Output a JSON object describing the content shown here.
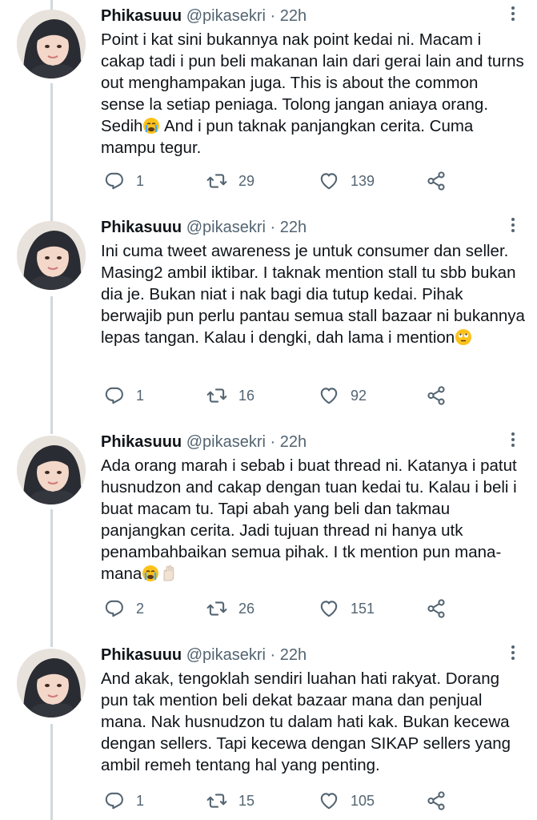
{
  "tweets": [
    {
      "name": "Phikasuuu",
      "handle": "@pikasekri",
      "separator": "·",
      "time": "22h",
      "text": "Point i kat sini bukannya nak point kedai ni. Macam i cakap tadi i pun beli makanan lain dari gerai lain and turns out menghampakan juga. This is about the common sense la setiap peniaga. Tolong jangan aniaya orang. Sedih",
      "text_after": " And i pun taknak panjangkan cerita. Cuma mampu tegur.",
      "emoji": "crying-face",
      "replies": "1",
      "retweets": "29",
      "likes": "139"
    },
    {
      "name": "Phikasuuu",
      "handle": "@pikasekri",
      "separator": "·",
      "time": "22h",
      "text": "Ini cuma tweet awareness je untuk consumer dan seller. Masing2 ambil iktibar. I taknak mention stall tu sbb bukan dia je. Bukan niat i nak bagi dia tutup kedai. Pihak berwajib pun perlu pantau semua stall bazaar ni bukannya lepas tangan. Kalau i dengki, dah lama i mention",
      "text_after": "",
      "emoji": "rolling-eyes-face",
      "replies": "1",
      "retweets": "16",
      "likes": "92"
    },
    {
      "name": "Phikasuuu",
      "handle": "@pikasekri",
      "separator": "·",
      "time": "22h",
      "text": "Ada orang marah i sebab i buat thread ni. Katanya i patut husnudzon and cakap dengan tuan kedai tu. Kalau i beli i buat macam tu. Tapi abah yang beli dan takmau panjangkan cerita. Jadi tujuan thread ni hanya utk penambahbaikan semua pihak. I tk mention pun mana-mana",
      "text_after": "",
      "emoji": "crying-face-raised-hand",
      "replies": "2",
      "retweets": "26",
      "likes": "151"
    },
    {
      "name": "Phikasuuu",
      "handle": "@pikasekri",
      "separator": "·",
      "time": "22h",
      "text": "And akak, tengoklah sendiri luahan hati rakyat. Dorang pun tak mention beli dekat bazaar mana dan penjual mana. Nak husnudzon tu dalam hati kak. Bukan kecewa dengan sellers. Tapi kecewa dengan SIKAP sellers yang ambil remeh tentang hal yang penting.",
      "text_after": "",
      "emoji": "",
      "replies": "1",
      "retweets": "15",
      "likes": "105"
    }
  ],
  "icons": {
    "reply": "reply-icon",
    "retweet": "retweet-icon",
    "like": "heart-icon",
    "share": "share-icon",
    "more": "more-options-icon"
  },
  "colors": {
    "text": "#0f1419",
    "secondary": "#536471",
    "thread_line": "#cfd9de",
    "background": "#ffffff"
  }
}
